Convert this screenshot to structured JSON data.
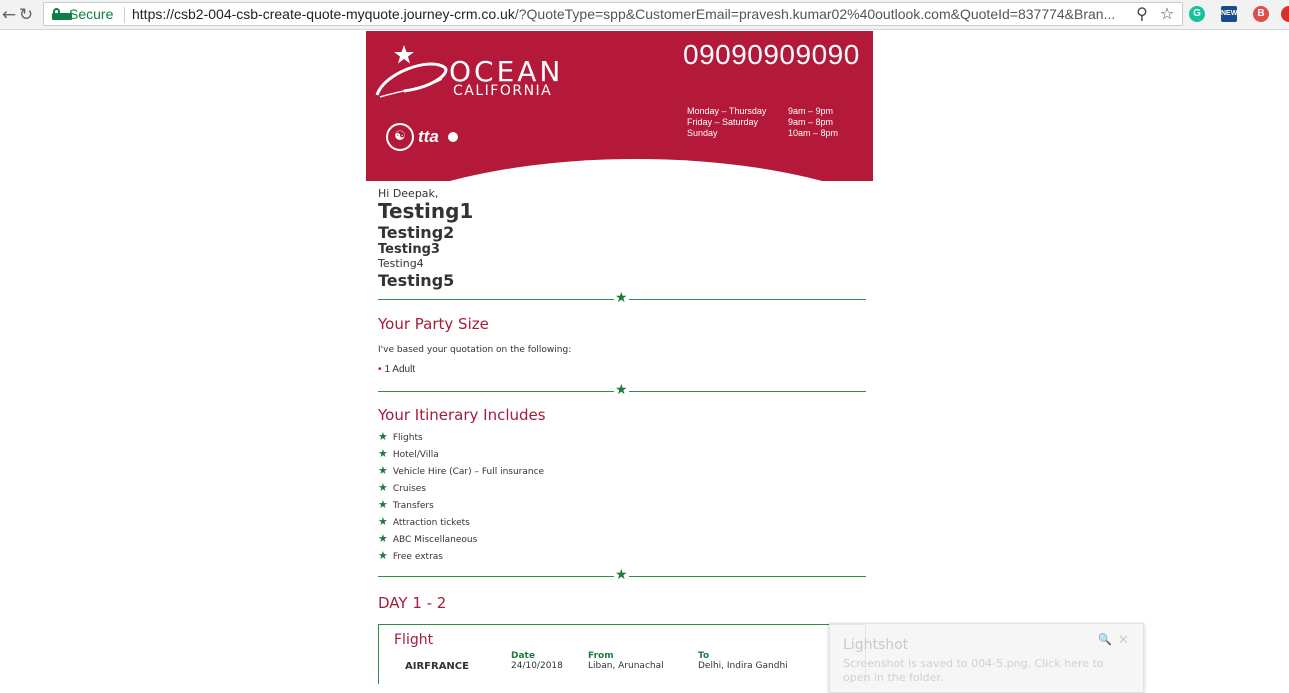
{
  "browser": {
    "secure_label": "Secure",
    "url_host": "https://csb2-004-csb-create-quote-myquote.journey-crm.co.uk",
    "url_rest": "/?QuoteType=spp&CustomerEmail=pravesh.kumar02%40outlook.com&QuoteId=837774&Bran...",
    "icons": [
      "back-icon",
      "reload-icon",
      "zoom-icon",
      "bookmark-star-icon",
      "grammarly-icon",
      "news-icon",
      "extension-icon"
    ]
  },
  "header": {
    "brand_line1": "OCEAN",
    "brand_line2": "CALIFORNIA",
    "phone": "09090909090",
    "hours": [
      {
        "day": "Monday – Thursday",
        "time": "9am  –  9pm"
      },
      {
        "day": "Friday   – Saturday",
        "time": "9am  –  8pm"
      },
      {
        "day": "Sunday",
        "time": "10am  –  8pm"
      }
    ],
    "badge_tta": "tta",
    "colors": {
      "brand_red": "#b4193a",
      "green": "#1f7a3d"
    }
  },
  "intro": {
    "greeting": "Hi Deepak,",
    "h1": "Testing1",
    "h2": "Testing2",
    "h3": "Testing3",
    "p": "Testing4",
    "h2b": "Testing5"
  },
  "party": {
    "title": "Your Party Size",
    "text": "I've based your quotation on the following:",
    "item": "1 Adult"
  },
  "itinerary": {
    "title": "Your Itinerary Includes",
    "items": [
      "Flights",
      "Hotel/Villa",
      "Vehicle Hire (Car) – Full insurance",
      "Cruises",
      "Transfers",
      "Attraction tickets",
      "ABC Miscellaneous",
      "Free extras"
    ]
  },
  "day": {
    "title": "DAY 1 - 2",
    "flight": {
      "title": "Flight",
      "headers": {
        "date": "Date",
        "from": "From",
        "to": "To"
      },
      "airline": "AIRFRANCE",
      "date": "24/10/2018",
      "from": "Liban, Arunachal",
      "to": "Delhi, Indira Gandhi"
    }
  },
  "toast": {
    "title": "Lightshot",
    "text": "Screenshot is saved to 004-5.png. Click here to open in the folder."
  }
}
